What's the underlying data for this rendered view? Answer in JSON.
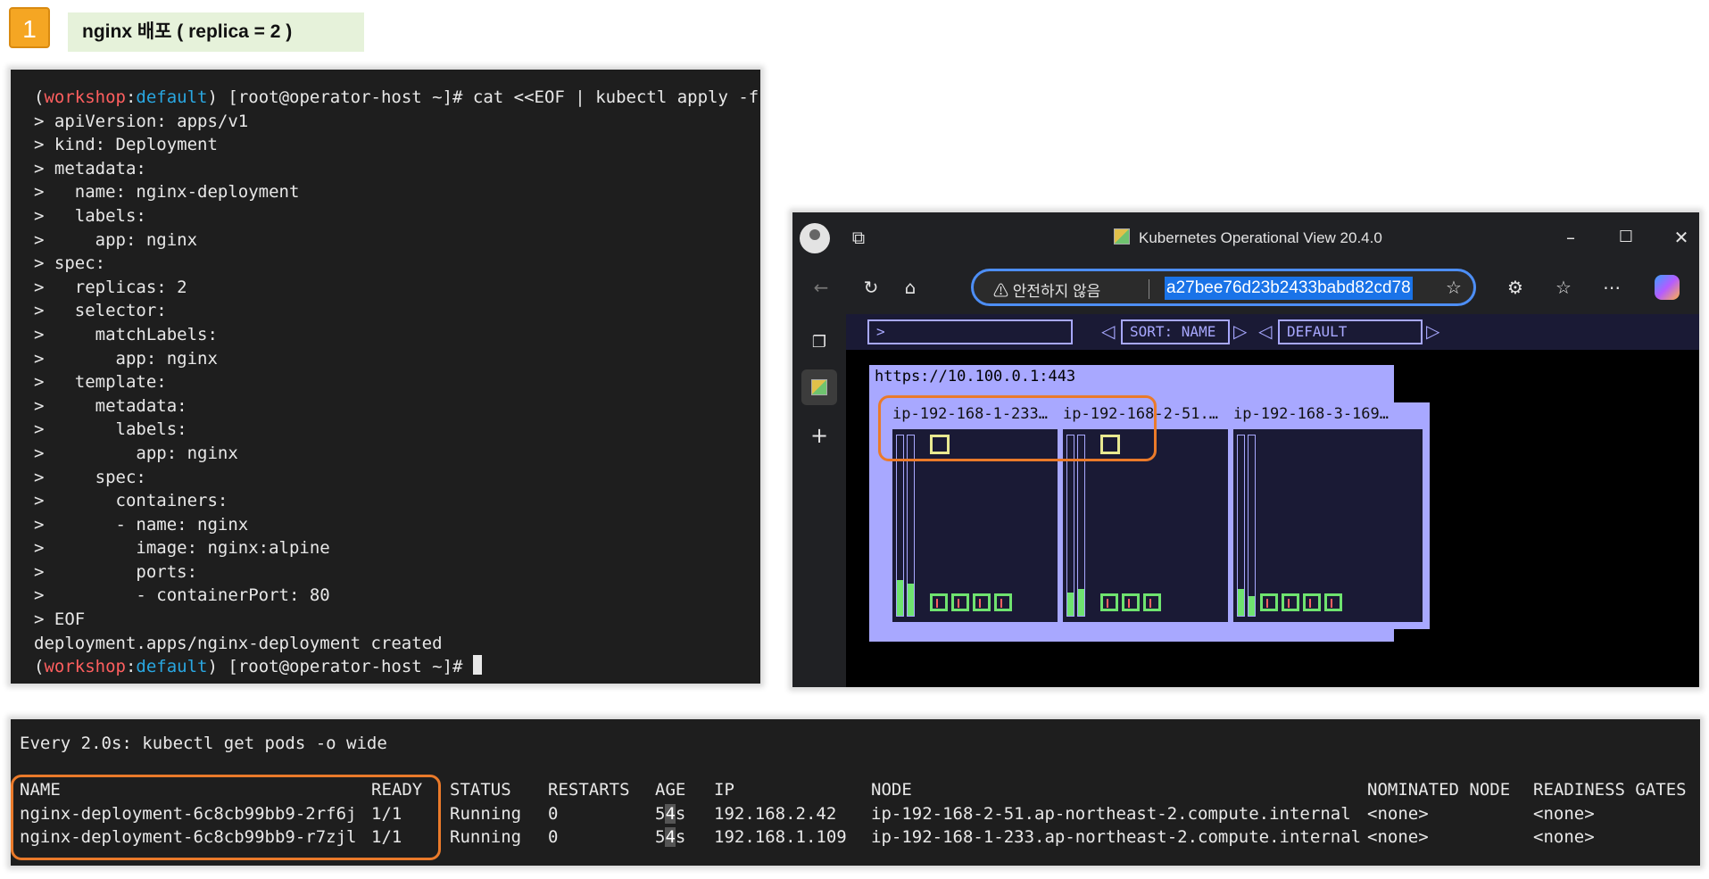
{
  "step": {
    "number": "1",
    "title": "nginx 배포 ( replica = 2 )"
  },
  "terminal": {
    "prompt_open": "(",
    "prompt_ws": "workshop",
    "prompt_colon": ":",
    "prompt_ns": "default",
    "prompt_rest": ") [root@operator-host ~]# ",
    "command": "cat <<EOF | kubectl apply -f -",
    "lines": [
      "> apiVersion: apps/v1",
      "> kind: Deployment",
      "> metadata:",
      ">   name: nginx-deployment",
      ">   labels:",
      ">     app: nginx",
      "> spec:",
      ">   replicas: 2",
      ">   selector:",
      ">     matchLabels:",
      ">       app: nginx",
      ">   template:",
      ">     metadata:",
      ">       labels:",
      ">         app: nginx",
      ">     spec:",
      ">       containers:",
      ">       - name: nginx",
      ">         image: nginx:alpine",
      ">         ports:",
      ">         - containerPort: 80",
      "> EOF",
      "deployment.apps/nginx-deployment created"
    ]
  },
  "browser": {
    "title": "Kubernetes Operational View 20.4.0",
    "security_warning": "안전하지 않음",
    "address": "a27bee76d23b2433babd82cd78"
  },
  "kubeview": {
    "filter_value": ">",
    "sort_label": "SORT: NAME",
    "theme_label": "DEFAULT",
    "cluster_url": "https://10.100.0.1:443",
    "nodes": [
      {
        "label": "ip-192-168-1-233…"
      },
      {
        "label": "ip-192-168-2-51.…"
      },
      {
        "label": "ip-192-168-3-169…"
      }
    ]
  },
  "watch": {
    "header": "Every 2.0s: kubectl get pods -o wide",
    "columns": [
      "NAME",
      "READY",
      "STATUS",
      "RESTARTS",
      "AGE",
      "IP",
      "NODE",
      "NOMINATED NODE",
      "READINESS GATES"
    ],
    "rows": [
      {
        "name": "nginx-deployment-6c8cb99bb9-2rf6j",
        "ready": "1/1",
        "status": "Running",
        "restarts": "0",
        "age_a": "5",
        "age_b": "4",
        "age_c": "s",
        "ip": "192.168.2.42",
        "node": "ip-192-168-2-51.ap-northeast-2.compute.internal",
        "nominated": "<none>",
        "gates": "<none>"
      },
      {
        "name": "nginx-deployment-6c8cb99bb9-r7zjl",
        "ready": "1/1",
        "status": "Running",
        "restarts": "0",
        "age_a": "5",
        "age_b": "4",
        "age_c": "s",
        "ip": "192.168.1.109",
        "node": "ip-192-168-1-233.ap-northeast-2.compute.internal",
        "nominated": "<none>",
        "gates": "<none>"
      }
    ]
  },
  "colors": {
    "accent_orange": "#ea7a2a",
    "kube_lavender": "#a8a8ff",
    "pod_green": "#6fe36f",
    "pod_yellow": "#e8e890"
  }
}
